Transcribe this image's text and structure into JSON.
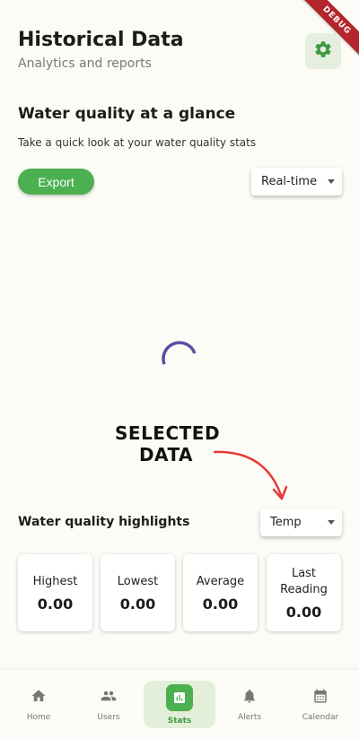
{
  "debug_banner": "DEBUG",
  "header": {
    "title": "Historical Data",
    "subtitle": "Analytics and reports"
  },
  "icons": {
    "settings": "gear-icon",
    "home": "home-icon",
    "users": "users-icon",
    "stats": "stats-icon",
    "alerts": "bell-icon",
    "calendar": "calendar-icon"
  },
  "section": {
    "title": "Water quality at a glance",
    "description": "Take a quick look at your water quality stats"
  },
  "export_label": "Export",
  "timeframe": {
    "selected": "Real-time"
  },
  "annotation": {
    "line1": "SELECTED",
    "line2": "DATA"
  },
  "highlights": {
    "title": "Water quality highlights",
    "metric_selected": "Temp",
    "cards": [
      {
        "label": "Highest",
        "value": "0.00"
      },
      {
        "label": "Lowest",
        "value": "0.00"
      },
      {
        "label": "Average",
        "value": "0.00"
      },
      {
        "label": "Last\nReading",
        "value": "0.00"
      }
    ]
  },
  "nav": [
    {
      "label": "Home"
    },
    {
      "label": "Users"
    },
    {
      "label": "Stats"
    },
    {
      "label": "Alerts"
    },
    {
      "label": "Calendar"
    }
  ],
  "colors": {
    "accent": "#4caf50",
    "background": "#fcfbf5",
    "spinner": "#5b4ea3",
    "annotation_arrow": "#e53935",
    "debug_ribbon": "#b3262d"
  }
}
